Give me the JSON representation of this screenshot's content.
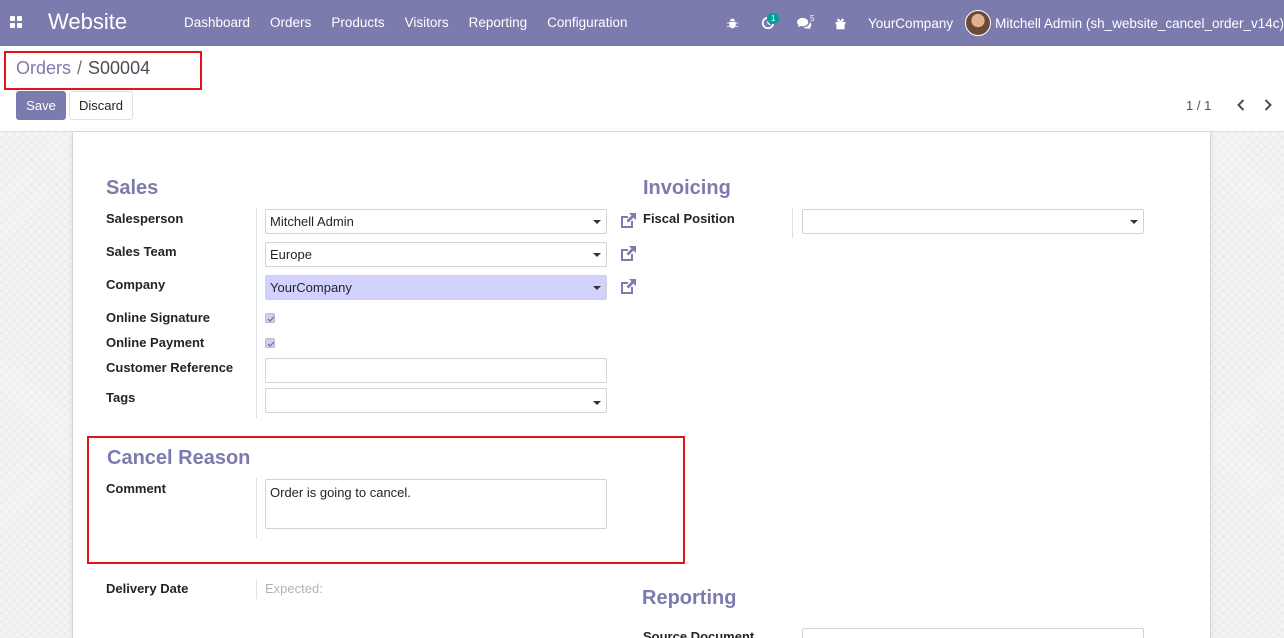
{
  "navbar": {
    "app_title": "Website",
    "menu": [
      "Dashboard",
      "Orders",
      "Products",
      "Visitors",
      "Reporting",
      "Configuration"
    ],
    "activity_count": "1",
    "messages_count": "5",
    "company": "YourCompany",
    "user": "Mitchell Admin (sh_website_cancel_order_v14c)"
  },
  "control_panel": {
    "breadcrumb_parent": "Orders",
    "breadcrumb_sep": "/",
    "breadcrumb_current": "S00004",
    "save_label": "Save",
    "discard_label": "Discard",
    "pager": "1 / 1"
  },
  "form": {
    "sales": {
      "title": "Sales",
      "salesperson_label": "Salesperson",
      "salesperson_value": "Mitchell Admin",
      "team_label": "Sales Team",
      "team_value": "Europe",
      "company_label": "Company",
      "company_value": "YourCompany",
      "online_signature_label": "Online Signature",
      "online_payment_label": "Online Payment",
      "customer_reference_label": "Customer Reference",
      "customer_reference_value": "",
      "tags_label": "Tags"
    },
    "invoicing": {
      "title": "Invoicing",
      "fiscal_position_label": "Fiscal Position",
      "fiscal_position_value": ""
    },
    "cancel_reason": {
      "title": "Cancel Reason",
      "comment_label": "Comment",
      "comment_value": "Order is going to cancel."
    },
    "delivery": {
      "label": "Delivery Date",
      "value": "Expected:"
    },
    "reporting": {
      "title": "Reporting",
      "source_document_label": "Source Document"
    }
  },
  "colors": {
    "brand": "#7c7bad",
    "highlight": "#e0141a",
    "company_field_bg": "#d2d2ff"
  }
}
